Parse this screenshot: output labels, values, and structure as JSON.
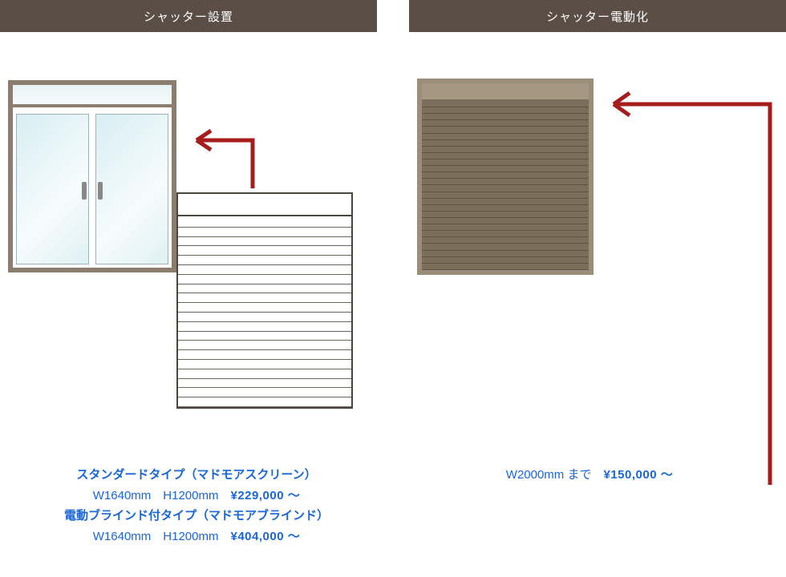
{
  "left": {
    "header": "シャッター設置",
    "product1": {
      "title": "スタンダードタイプ（マドモアスクリーン）",
      "dims": "W1640mm　H1200mm　",
      "price": "¥229,000 ～"
    },
    "product2": {
      "title": "電動ブラインド付タイプ（マドモアブラインド）",
      "dims": "W1640mm　H1200mm　",
      "price": "¥404,000 ～"
    }
  },
  "right": {
    "header": "シャッター電動化",
    "product": {
      "dims": "W2000mm まで　",
      "price": "¥150,000 ～"
    }
  }
}
